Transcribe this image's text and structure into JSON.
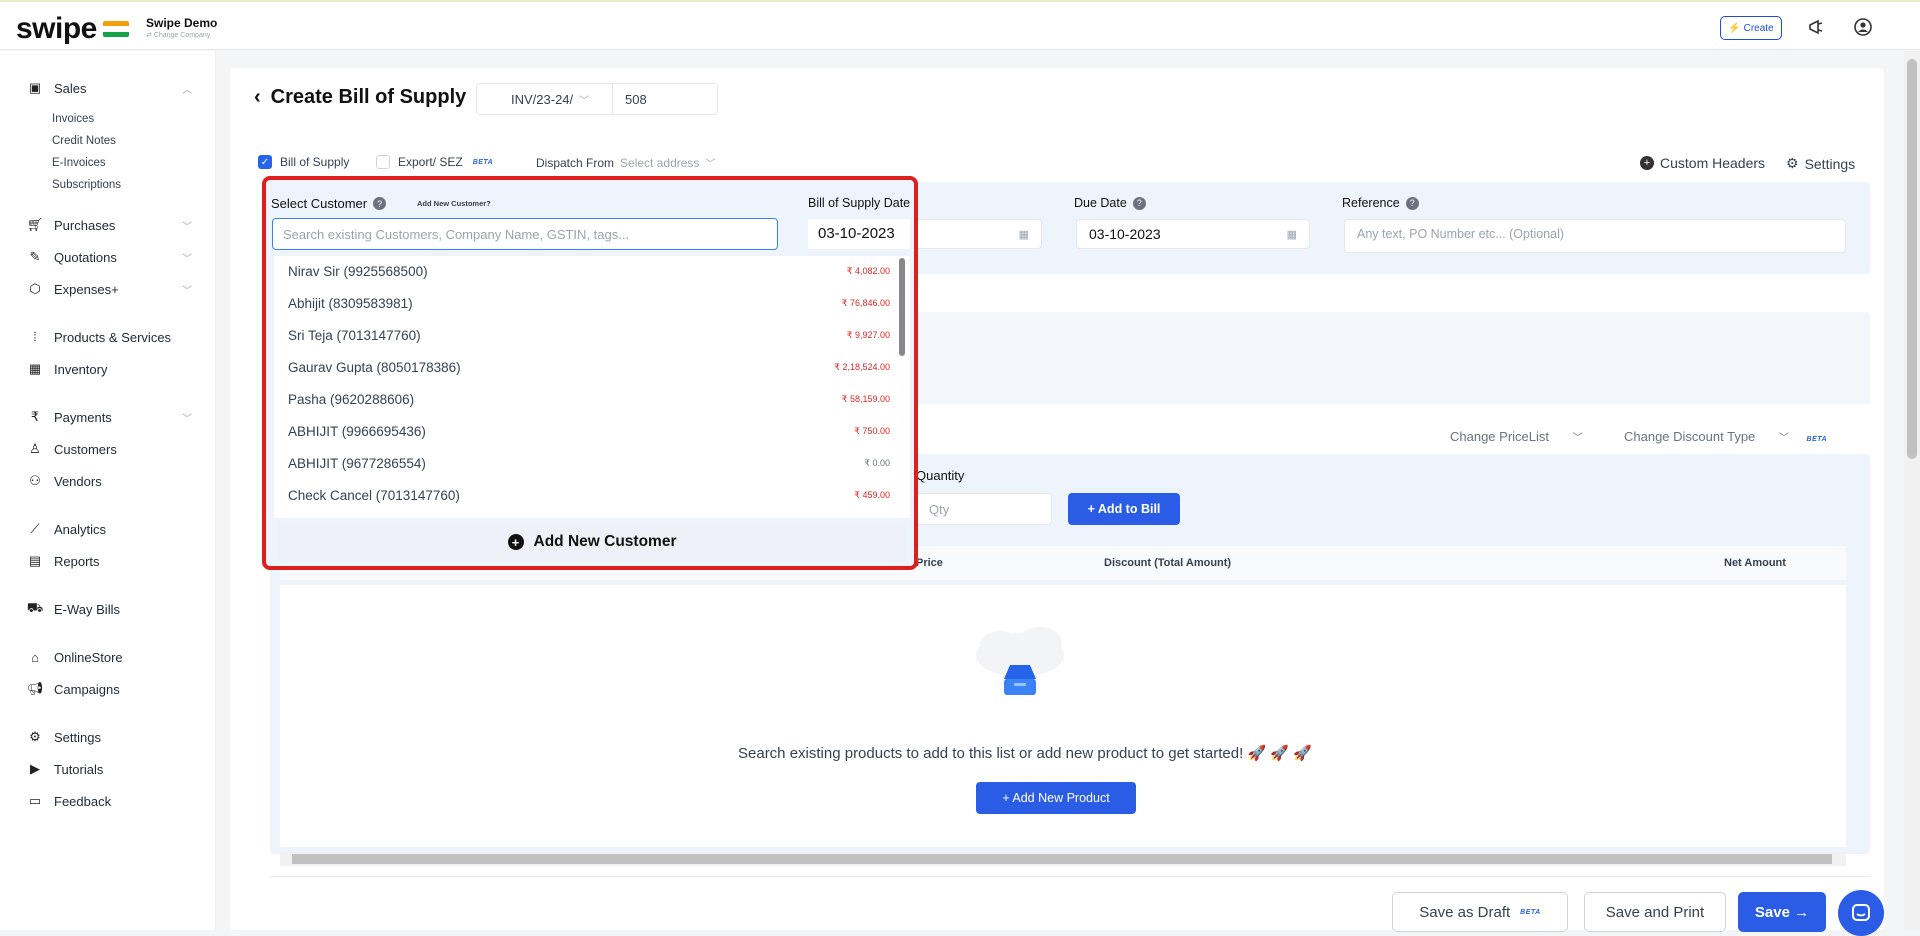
{
  "app": {
    "logo": "swipe",
    "company_name": "Swipe Demo",
    "company_sub": "⇄ Change Company",
    "create_label": "⚡ Create"
  },
  "sidebar": {
    "sales": "Sales",
    "sales_sub": [
      "Invoices",
      "Credit Notes",
      "E-Invoices",
      "Subscriptions"
    ],
    "purchases": "Purchases",
    "quotations": "Quotations",
    "expenses": "Expenses+",
    "products": "Products & Services",
    "inventory": "Inventory",
    "payments": "Payments",
    "customers": "Customers",
    "vendors": "Vendors",
    "analytics": "Analytics",
    "reports": "Reports",
    "eway": "E-Way Bills",
    "onlinestore": "OnlineStore",
    "campaigns": "Campaigns",
    "settings": "Settings",
    "tutorials": "Tutorials",
    "feedback": "Feedback"
  },
  "header": {
    "title": "Create Bill of Supply",
    "invoice_prefix": "INV/23-24/",
    "invoice_number": "508"
  },
  "options": {
    "bill_of_supply": "Bill of Supply",
    "export_sez": "Export/ SEZ",
    "beta": "BETA",
    "dispatch_from": "Dispatch From",
    "select_address": "Select address",
    "custom_headers": "Custom Headers",
    "settings": "Settings"
  },
  "form": {
    "select_customer": "Select Customer",
    "add_new_customer_link": "Add New Customer?",
    "search_placeholder": "Search existing Customers, Company Name, GSTIN, tags...",
    "bill_date_label": "Bill of Supply Date",
    "bill_date": "03-10-2023",
    "due_date_label": "Due Date",
    "due_date": "03-10-2023",
    "reference_label": "Reference",
    "reference_placeholder": "Any text, PO Number etc... (Optional)"
  },
  "customers": [
    {
      "name": "Nirav Sir (9925568500)",
      "amount": "₹ 4,082.00"
    },
    {
      "name": "Abhijit (8309583981)",
      "amount": "₹ 76,846.00"
    },
    {
      "name": "Sri Teja (7013147760)",
      "amount": "₹ 9,927.00"
    },
    {
      "name": "Gaurav Gupta (8050178386)",
      "amount": "₹ 2,18,524.00"
    },
    {
      "name": "Pasha (9620288606)",
      "amount": "₹ 58,159.00"
    },
    {
      "name": "ABHIJIT (9966695436)",
      "amount": "₹ 750.00"
    },
    {
      "name": "ABHIJIT (9677286554)",
      "amount": "₹ 0.00"
    },
    {
      "name": "Check Cancel (7013147760)",
      "amount": "₹ 459.00"
    }
  ],
  "add_new_customer_button": "Add New Customer",
  "items": {
    "change_pricelist": "Change PriceList",
    "change_discount": "Change Discount Type",
    "beta": "BETA",
    "quantity_label": "Quantity",
    "qty_placeholder": "Qty",
    "add_to_bill": "+ Add to Bill",
    "col_price": "Price",
    "col_discount": "Discount (Total Amount)",
    "col_net": "Net Amount",
    "empty_message": "Search existing products to add to this list or add new product to get started! 🚀 🚀 🚀",
    "add_new_product": "+ Add New Product"
  },
  "footer": {
    "save_draft": "Save as Draft",
    "beta": "BETA",
    "save_print": "Save and Print",
    "save": "Save →"
  }
}
